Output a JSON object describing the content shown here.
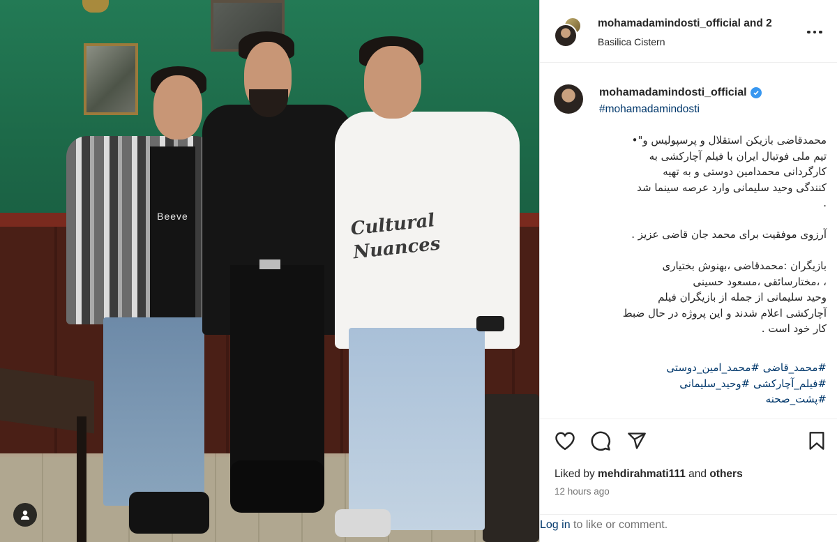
{
  "post": {
    "header": {
      "usernames": "mohamadamindosti_official and 2",
      "location": "Basilica Cistern"
    },
    "caption": {
      "username": "mohamadamindosti_official",
      "hashtag_line": "#mohamadamindosti",
      "lines": [
        "محمدقاضی بازیکن استقلال و پرسپولیس و\"•",
        "تیم ملی فوتبال ایران با فیلم آچارکشی به",
        "کارگردانی محمدامین دوستی و به تهیه",
        "کنندگی وحید سلیمانی وارد عرصه سینما شد",
        ".",
        "",
        "آرزوی موفقیت برای محمد جان قاضی عزیز .",
        "",
        "بازیگران :محمدقاضی ،بهنوش بختیاری",
        "، ،مختارسائقی ،مسعود حسینی",
        "وحید سلیمانی از جمله از بازیگران فیلم",
        "آچارکشی اعلام شدند و این پروژه در حال ضبط",
        "کار خود است ."
      ],
      "hashtags": [
        "#محمد_قاضی #محمد_امین_دوستی",
        "#فیلم_آچارکشی #وحید_سلیمانی",
        "#پشت_صحنه"
      ]
    },
    "photo": {
      "shirt_print": [
        "Cultural",
        "Nuances"
      ],
      "tshirt_text": "Beeve"
    },
    "likes": {
      "prefix": "Liked by ",
      "user": "mehdirahmati111",
      "middle": " and ",
      "suffix": "others"
    },
    "timestamp": "12 hours ago",
    "login_prompt": {
      "link": "Log in",
      "rest": " to like or comment."
    }
  },
  "icons": {
    "more": "more-horizontal-icon",
    "like": "heart-icon",
    "comment": "comment-icon",
    "share": "share-icon",
    "save": "bookmark-icon",
    "tags": "user-tag-icon",
    "verified": "verified-badge-icon"
  },
  "colors": {
    "link": "#00376b",
    "verified": "#3897f0",
    "muted": "#737373",
    "text": "#262626"
  }
}
